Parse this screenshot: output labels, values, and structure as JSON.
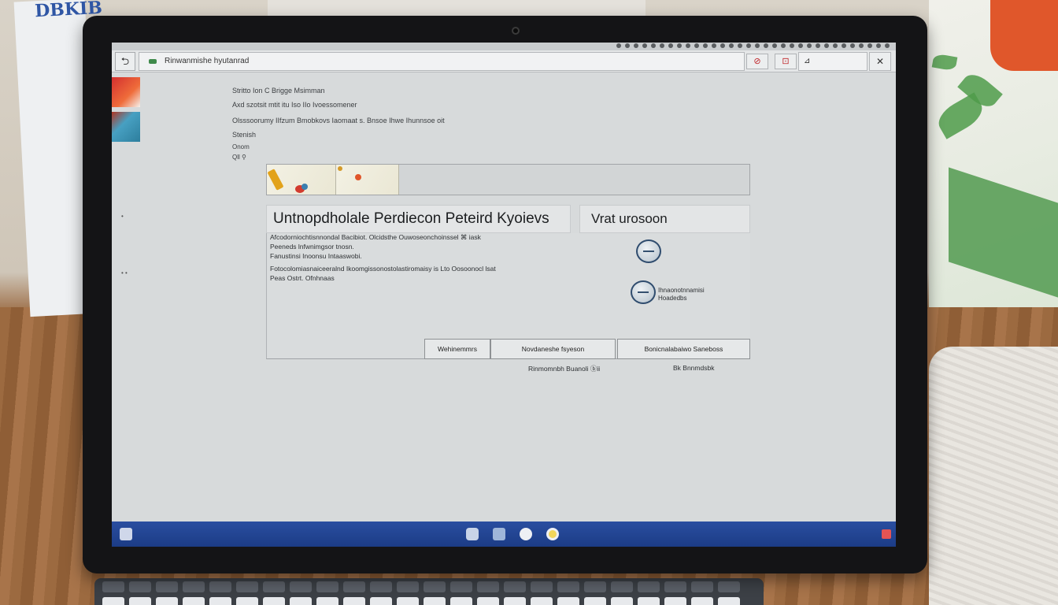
{
  "backdrop": {
    "paper_scribble": "DBKIB"
  },
  "browser": {
    "back_glyph": "⮌",
    "url": "Rinwanmishe hyutanrad",
    "toolbar_glyph_1": "⊘",
    "toolbar_glyph_2": "⊡",
    "menu_label": "⊿",
    "close_glyph": "✕"
  },
  "page": {
    "lines": [
      "Stritto Ion C Brigge Msimman",
      "Axd szotsit mtit itu Iso IIo Ivoessomener",
      "Olsssoorumy IIfzum Bmobkovs Iaomaat s. Bnsoe Ihwe Ihunnsoe oit",
      "Stenish",
      "Onom",
      "Qll ⚲"
    ],
    "heading": "Untnopdholale Perdiecon Peteird Kyoievs",
    "side_heading": "Vrat urosoon",
    "body_lines": [
      "Afcodorniochtisnnondal Bacibiot. Olcidsthe Ouwoseonchoinssel ⌘ iask",
      "Peeneds lnfwnimgsor tnosn.",
      "Fanustinsi Inoonsu Intaaswobi.",
      "Fotocolomiasnaiceeralnd Ikoomgissonostolastiromaisy is Lto Oosoonocl lsat",
      "Peas Ostrt. Ofnhnaas"
    ],
    "circle_label_1": "Ihnaonotnnamisi",
    "circle_label_2": "Hoadedbs",
    "buttons": [
      "Wehinemmrs",
      "Novdaneshe fsyeson",
      "Bonicnalabaiwo Saneboss"
    ],
    "footer_1": "Rinmomnbh Buanoli ⓑii",
    "footer_2": "Bk Bnnmdsbk"
  },
  "colors": {
    "taskbar": "#1c3c86",
    "accent": "#2f4c6e",
    "warning": "#c0262b"
  }
}
